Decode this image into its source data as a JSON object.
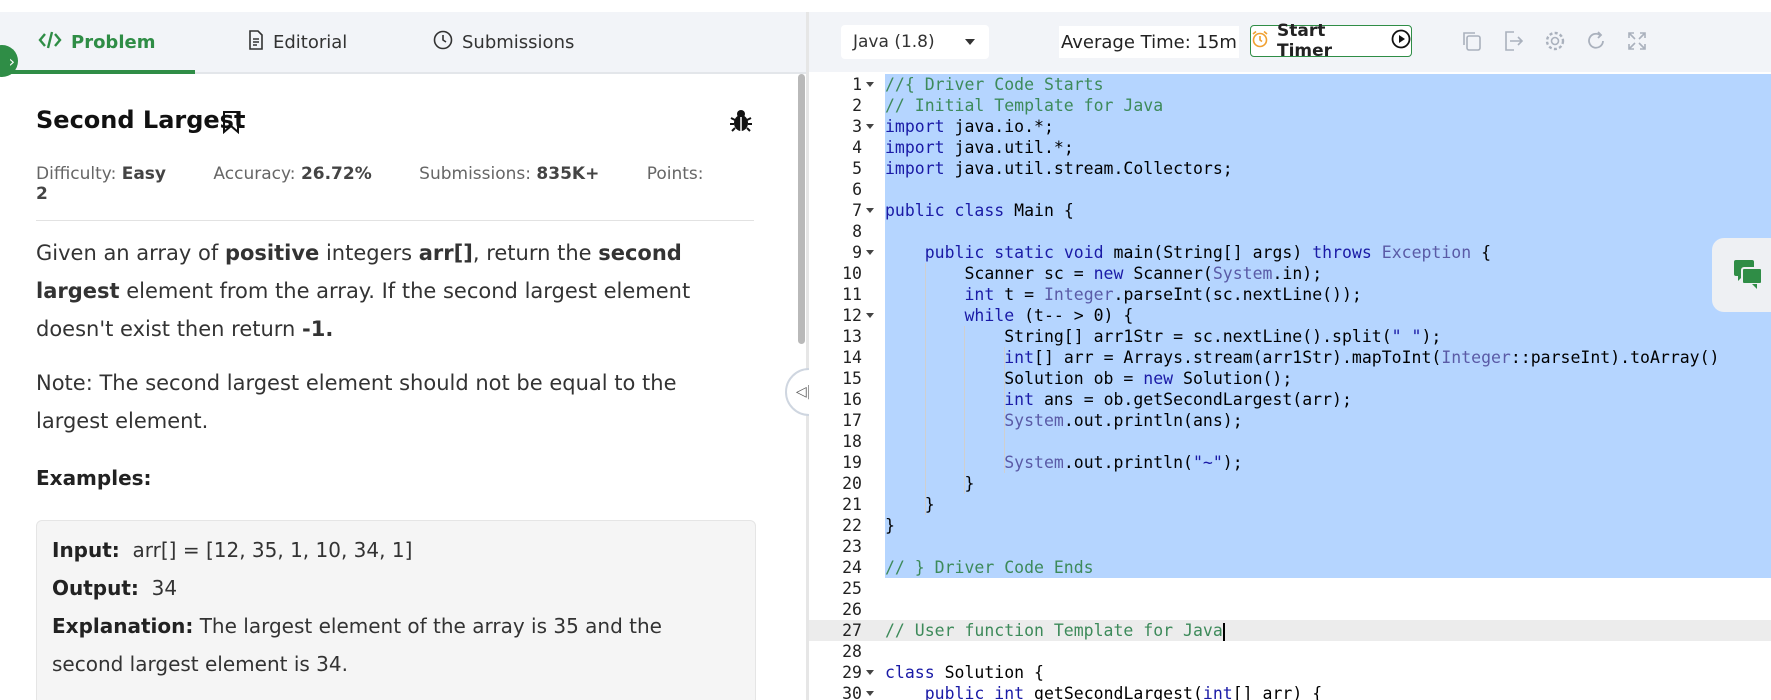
{
  "tabs": [
    {
      "label": "Problem",
      "icon": "code-icon",
      "active": true
    },
    {
      "label": "Editorial",
      "icon": "document-icon",
      "active": false
    },
    {
      "label": "Submissions",
      "icon": "clock-icon",
      "active": false
    }
  ],
  "problem": {
    "title": "Second Largest",
    "difficulty_label": "Difficulty:",
    "difficulty": "Easy",
    "accuracy_label": "Accuracy:",
    "accuracy": "26.72%",
    "submissions_label": "Submissions:",
    "submissions": "835K+",
    "points_label": "Points:",
    "points": "2",
    "desc": {
      "p1": "Given an array of ",
      "b1": "positive",
      "p2": " integers ",
      "b2": "arr[]",
      "p3": ", return the ",
      "b3": "second largest",
      "p4": " element from the array. If the second largest element doesn't exist then return ",
      "b4": "-1."
    },
    "note": "Note: The second largest element should not be equal to the largest element.",
    "examples_heading": "Examples:",
    "example": {
      "input_label": "Input:",
      "input": "arr[] = [12, 35, 1, 10, 34, 1]",
      "output_label": "Output:",
      "output": "34",
      "explanation_label": "Explanation:",
      "explanation_1": "The largest element of the array is 35 and the",
      "explanation_2": "second largest element is 34."
    }
  },
  "toolbar": {
    "language": "Java (1.8)",
    "avg_time": "Average Time: 15m",
    "timer_label": "Start Timer"
  },
  "colors": {
    "brand_green": "#2f8d46",
    "selection": "#b5d5ff"
  },
  "code_lines": [
    {
      "n": "1",
      "text": "//{ Driver Code Starts"
    },
    {
      "n": "2",
      "text": "// Initial Template for Java"
    },
    {
      "n": "3",
      "text": "import java.io.*;"
    },
    {
      "n": "4",
      "text": "import java.util.*;"
    },
    {
      "n": "5",
      "text": "import java.util.stream.Collectors;"
    },
    {
      "n": "6",
      "text": ""
    },
    {
      "n": "7",
      "text": "public class Main {"
    },
    {
      "n": "8",
      "text": ""
    },
    {
      "n": "9",
      "text": "    public static void main(String[] args) throws Exception {"
    },
    {
      "n": "10",
      "text": "        Scanner sc = new Scanner(System.in);"
    },
    {
      "n": "11",
      "text": "        int t = Integer.parseInt(sc.nextLine());"
    },
    {
      "n": "12",
      "text": "        while (t-- > 0) {"
    },
    {
      "n": "13",
      "text": "            String[] arr1Str = sc.nextLine().split(\" \");"
    },
    {
      "n": "14",
      "text": "            int[] arr = Arrays.stream(arr1Str).mapToInt(Integer::parseInt).toArray()"
    },
    {
      "n": "15",
      "text": "            Solution ob = new Solution();"
    },
    {
      "n": "16",
      "text": "            int ans = ob.getSecondLargest(arr);"
    },
    {
      "n": "17",
      "text": "            System.out.println(ans);"
    },
    {
      "n": "18",
      "text": ""
    },
    {
      "n": "19",
      "text": "            System.out.println(\"~\");"
    },
    {
      "n": "20",
      "text": "        }"
    },
    {
      "n": "21",
      "text": "    }"
    },
    {
      "n": "22",
      "text": "}"
    },
    {
      "n": "23",
      "text": ""
    },
    {
      "n": "24",
      "text": "// } Driver Code Ends"
    },
    {
      "n": "25",
      "text": ""
    },
    {
      "n": "26",
      "text": ""
    },
    {
      "n": "27",
      "text": "// User function Template for Java"
    },
    {
      "n": "28",
      "text": ""
    },
    {
      "n": "29",
      "text": "class Solution {"
    },
    {
      "n": "30",
      "text": "    public int getSecondLargest(int[] arr) {"
    }
  ]
}
